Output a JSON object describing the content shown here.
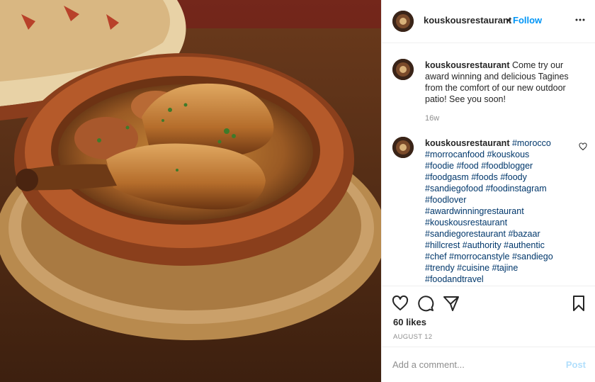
{
  "post": {
    "image_alt": "Chicken tagine in a clay dish on a wooden board",
    "header": {
      "username": "kouskousrestaurant",
      "separator": "•",
      "follow_label": "Follow"
    },
    "caption": {
      "username": "kouskousrestaurant",
      "text": "Come try our award winning and delicious Tagines from the comfort of our new outdoor patio! See you soon!",
      "time": "16w"
    },
    "comment": {
      "username": "kouskousrestaurant",
      "lines": [
        "#morocco",
        "#morrocanfood #kouskous",
        "#foodie #food #foodblogger",
        "#foodgasm #foods #foody",
        "#sandiegofood #foodinstagram",
        "#foodlover",
        "#awardwinningrestaurant",
        "#kouskousrestaurant",
        "#sandiegorestaurant #bazaar",
        "#hillcrest #authority #authentic",
        "#chef #morrocanstyle #sandiego",
        "#trendy #cuisine #tajine",
        "#foodandtravel"
      ]
    },
    "likes": "60 likes",
    "date": "AUGUST 12",
    "add_comment_placeholder": "Add a comment...",
    "post_label": "Post"
  },
  "icons": {
    "more": "more-horizontal-icon",
    "like": "heart-icon",
    "comment": "comment-bubble-icon",
    "share": "paper-plane-icon",
    "save": "bookmark-icon",
    "comment_like": "small-heart-icon"
  },
  "colors": {
    "link_blue": "#0095f6",
    "hashtag": "#00376b",
    "text": "#262626",
    "muted": "#8e8e8e",
    "post_disabled": "#b2dffc"
  }
}
